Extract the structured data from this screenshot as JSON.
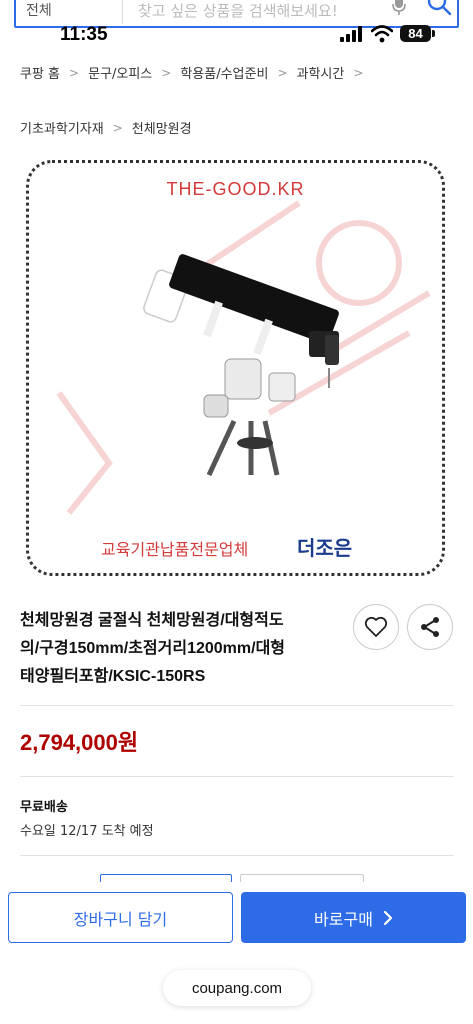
{
  "search": {
    "category": "전체",
    "placeholder": "찾고 싶은 상품을 검색해보세요!"
  },
  "status_bar": {
    "time": "11:35",
    "battery": "84"
  },
  "breadcrumb": {
    "items": [
      "쿠팡 홈",
      "문구/오피스",
      "학용품/수업준비",
      "과학시간"
    ],
    "sub_items": [
      "기초과학기자재",
      "천체망원경"
    ]
  },
  "product_image": {
    "brand_text": "THE-GOOD.KR",
    "caption": "교육기관납품전문업체",
    "logo_text": "더조은",
    "watermark": "더조은"
  },
  "product": {
    "title_lines": [
      "천체망원경 굴절식 천체망원경/대형적도",
      "의/구경150mm/초점거리1200mm/대형",
      "태양필터포함/KSIC-150RS"
    ],
    "price": "2,794,000원"
  },
  "shipping": {
    "label": "무료배송",
    "arrival": "수요일 12/17 도착 예정"
  },
  "actions": {
    "cart_label": "장바구니 담기",
    "buy_label": "바로구매"
  },
  "browser": {
    "url": "coupang.com"
  },
  "colors": {
    "accent": "#2e6be6",
    "price": "#ae0000",
    "watermark": "#d43a3a"
  },
  "icons": {
    "mic": "mic-icon",
    "search": "search-icon",
    "heart": "heart-icon",
    "share": "share-icon",
    "chevron": "chevron-right-icon"
  }
}
